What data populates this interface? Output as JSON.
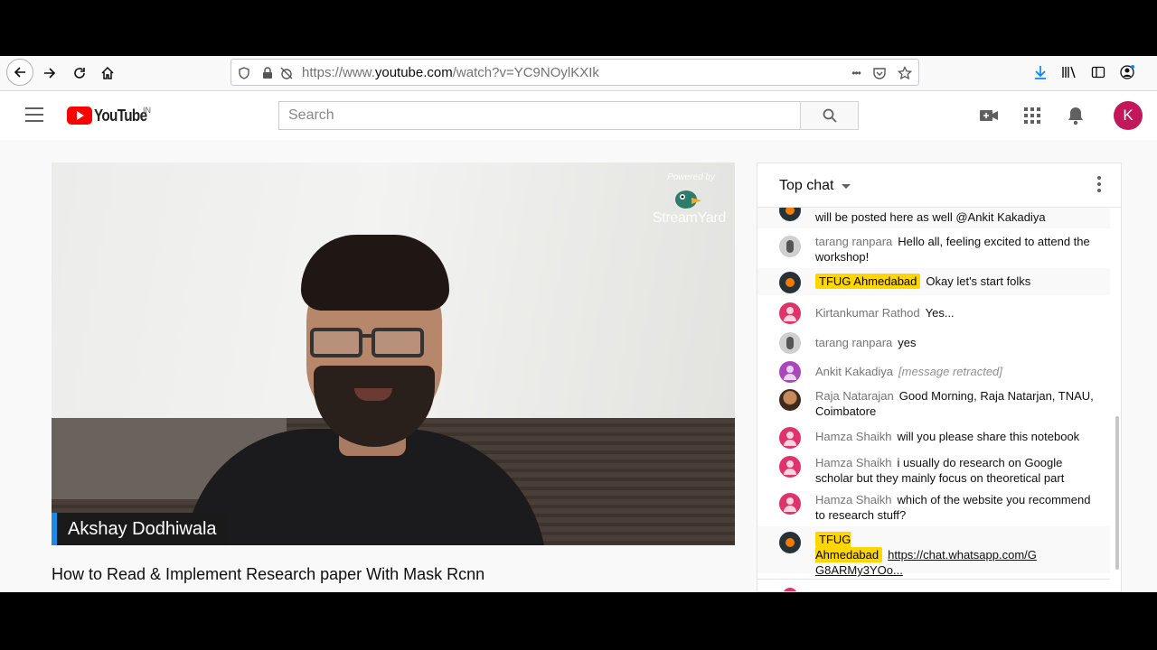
{
  "browser": {
    "url_prefix": "https://www.",
    "url_domain": "youtube.com",
    "url_path": "/watch?v=YC9NOylKXIk",
    "more_dots": "•••"
  },
  "youtube": {
    "logo_text": "YouTube",
    "country_code": "IN",
    "search_placeholder": "Search",
    "avatar_letter": "K",
    "brand_color": "#ff0000",
    "avatar_color": "#c2185b"
  },
  "video": {
    "title": "How to Read & Implement Research paper With Mask Rcnn",
    "speaker_name": "Akshay Dodhiwala",
    "overlay_powered": "Powered by",
    "overlay_brand": "StreamYard",
    "lower_third_color": "#1e88e5"
  },
  "chat": {
    "title": "Top chat",
    "messages": [
      {
        "author": "",
        "text": "will be posted here as well @Ankit Kakadiya",
        "avatar": "owner"
      },
      {
        "author": "tarang ranpara",
        "text": "Hello all, feeling excited to attend the workshop!",
        "avatar": "tarang"
      },
      {
        "author": "TFUG Ahmedabad",
        "text": "Okay let's start folks",
        "avatar": "owner",
        "owner": true
      },
      {
        "author": "Kirtankumar Rathod",
        "text": "Yes...",
        "avatar": "pink"
      },
      {
        "author": "tarang ranpara",
        "text": "yes",
        "avatar": "tarang"
      },
      {
        "author": "Ankit Kakadiya",
        "text": "[message retracted]",
        "avatar": "purple"
      },
      {
        "author": "Raja Natarajan",
        "text": "Good Morning, Raja Natarjan, TNAU, Coimbatore",
        "avatar": "photo"
      },
      {
        "author": "Hamza Shaikh",
        "text": "will you please share this notebook",
        "avatar": "pink"
      },
      {
        "author": "Hamza Shaikh",
        "text": "i usually do research on Google scholar but they mainly focus on theoretical part",
        "avatar": "pink"
      },
      {
        "author": "Hamza Shaikh",
        "text": "which of the website you recommend to research stuff?",
        "avatar": "pink"
      },
      {
        "author": "TFUG Ahmedabad",
        "text": "https://chat.whatsapp.com/G G8ARMy3YOo...",
        "avatar": "owner",
        "owner": true
      }
    ]
  }
}
